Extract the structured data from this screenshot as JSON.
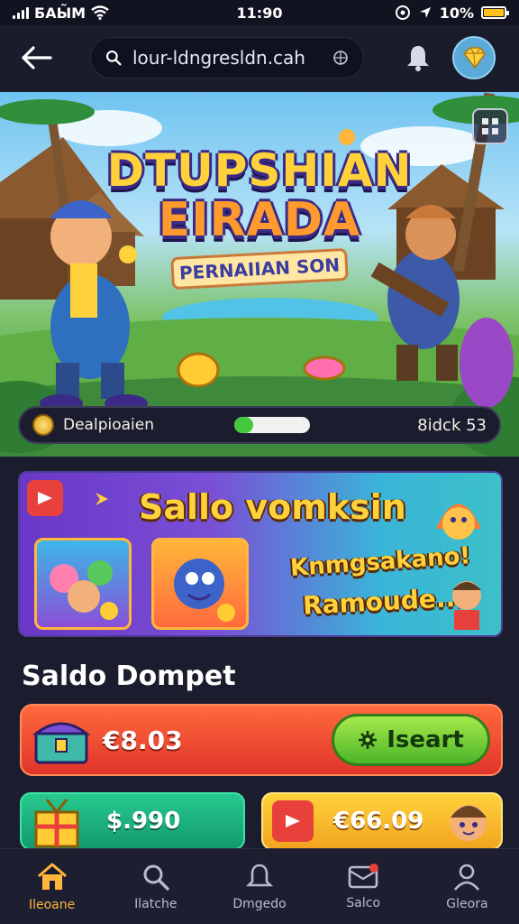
{
  "status_bar": {
    "carrier": "БАЫ̃М",
    "time": "11:90",
    "battery": "10%"
  },
  "header": {
    "search_value": "lour-ldngresldn.cah"
  },
  "hero": {
    "title_line1": "DTUPSHIAN",
    "title_line2": "EIRADA",
    "subtitle": "PERNAIIAN SON",
    "progress_label": "Dealpioaien",
    "progress_right": "8idck 53",
    "progress_fraction": 0.25
  },
  "promo": {
    "heading": "Sallo vomksin",
    "line1": "Knmgsakano!",
    "line2": "Ramoude..."
  },
  "wallet": {
    "section_title": "Saldo Dompet",
    "main_amount": "€8.03",
    "insert_label": "Iseart",
    "card2_amount": "$.990",
    "card3_amount": "€66.09"
  },
  "nav": {
    "items": [
      {
        "label": "Ileoane",
        "icon": "home-icon"
      },
      {
        "label": "Ilatche",
        "icon": "search-icon"
      },
      {
        "label": "Dmgedo",
        "icon": "bell-icon"
      },
      {
        "label": "Salco",
        "icon": "message-icon"
      },
      {
        "label": "Gleora",
        "icon": "profile-icon"
      }
    ]
  },
  "colors": {
    "background": "#1b1d2e",
    "accent_orange": "#ffb63a",
    "wallet_red": "#e0342a",
    "wallet_green": "#139a6c",
    "wallet_yellow": "#f2a51f",
    "button_green": "#4bb62a"
  }
}
